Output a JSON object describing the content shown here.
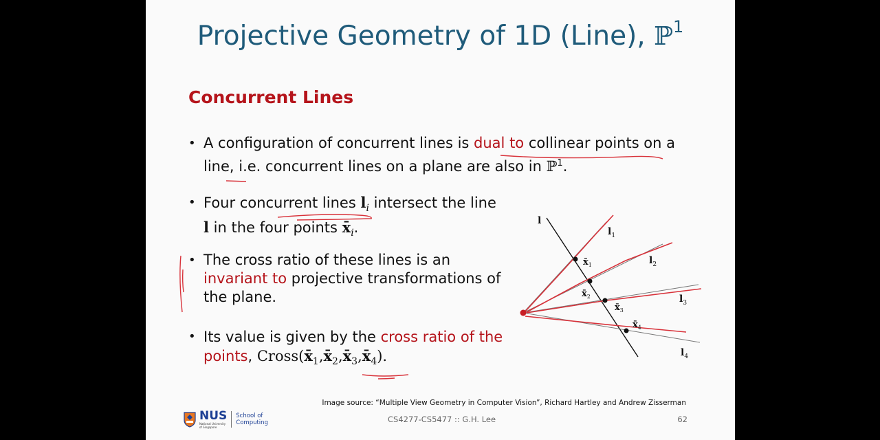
{
  "slide": {
    "title": "Projective Geometry of 1D (Line), ",
    "title_symbol": "ℙ",
    "title_sup": "1",
    "section_heading": "Concurrent Lines",
    "bullets": {
      "b1": {
        "a": "A configuration of concurrent lines is ",
        "hl": "dual to",
        "b": " collinear points on a line, i.e. concurrent lines on a plane are also in ",
        "sym": "ℙ",
        "sup": "1",
        "end": "."
      },
      "b2": {
        "a": "Four concurrent lines ",
        "l": "l",
        "li_sub": "i",
        "b": " intersect the line ",
        "l2": "l",
        "c": " in the four points ",
        "x": "x̄",
        "x_sub": "i",
        "end": "."
      },
      "b3": {
        "a": "The cross ratio of these lines is an ",
        "hl": "invariant to",
        "b": " projective transformations of the plane."
      },
      "b4": {
        "a": "Its value is given by the ",
        "hl": "cross ratio of the points",
        "b": ", ",
        "func": "Cross(",
        "args": [
          {
            "x": "x̄",
            "sub": "1"
          },
          {
            "x": "x̄",
            "sub": "2"
          },
          {
            "x": "x̄",
            "sub": "3"
          },
          {
            "x": "x̄",
            "sub": "4"
          }
        ],
        "close": ")."
      }
    },
    "figure": {
      "line_label": "l",
      "lines": [
        {
          "label": "l",
          "sub": "1"
        },
        {
          "label": "l",
          "sub": "2"
        },
        {
          "label": "l",
          "sub": "3"
        },
        {
          "label": "l",
          "sub": "4"
        }
      ],
      "points": [
        {
          "label": "x̄",
          "sub": "1"
        },
        {
          "label": "x̄",
          "sub": "2"
        },
        {
          "label": "x̄",
          "sub": "3"
        },
        {
          "label": "x̄",
          "sub": "4"
        }
      ]
    },
    "footer": {
      "source": "Image source: “Multiple View Geometry in Computer Vision”, Richard Hartley and Andrew Zisserman",
      "course": "CS4277-CS5477 :: G.H. Lee",
      "page": "62"
    },
    "logo": {
      "nus": "NUS",
      "nus_sub": "National University of Singapore",
      "school_line1": "School of",
      "school_line2": "Computing"
    }
  },
  "colors": {
    "title": "#1f5b7a",
    "accent_red": "#b5141b",
    "annotation_red": "#d8323a"
  }
}
